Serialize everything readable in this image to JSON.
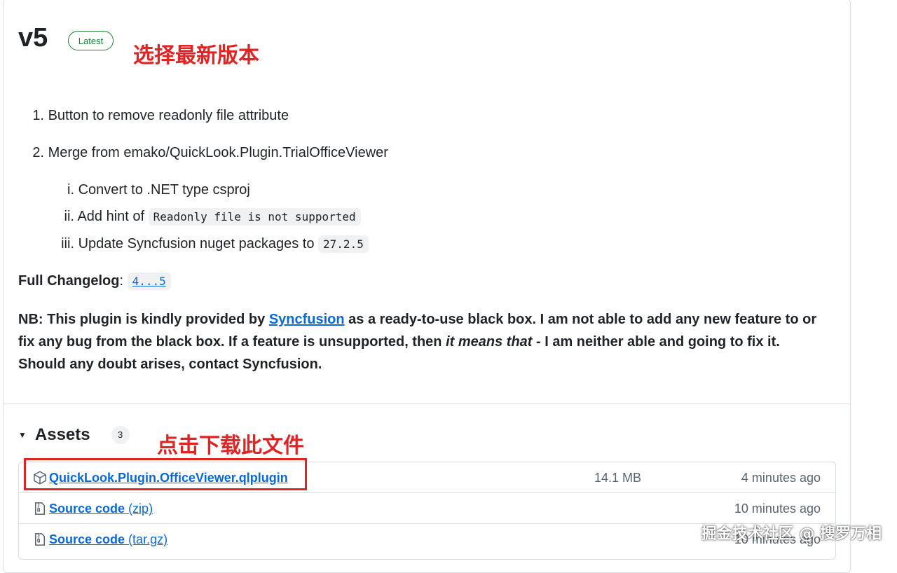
{
  "release": {
    "version": "v5",
    "badge": "Latest",
    "annotation_select": "选择最新版本",
    "notes": [
      {
        "num": "1.",
        "text": "Button to remove readonly file attribute"
      },
      {
        "num": "2.",
        "text": "Merge from emako/QuickLook.Plugin.TrialOfficeViewer"
      }
    ],
    "subnotes": [
      {
        "num": "i.",
        "text": "Convert to .NET type csproj",
        "code": ""
      },
      {
        "num": "ii.",
        "text": "Add hint of",
        "code": "Readonly file is not supported"
      },
      {
        "num": "iii.",
        "text": "Update Syncfusion nuget packages to",
        "code": "27.2.5"
      }
    ],
    "changelog_label": "Full Changelog",
    "changelog_link": "4...5",
    "nb_prefix": "NB: This plugin is kindly provided by",
    "nb_link": "Syncfusion",
    "nb_middle": "as a ready-to-use black box. I am not able to add any new feature to or fix any bug from the black box. If a feature is unsupported, then",
    "nb_italic": "it means that",
    "nb_suffix": "- I am neither able and going to fix it. Should any doubt arises, contact Syncfusion."
  },
  "assets": {
    "title": "Assets",
    "count": "3",
    "annotation_download": "点击下载此文件",
    "items": [
      {
        "name": "QuickLook.Plugin.OfficeViewer.qlplugin",
        "suffix": "",
        "size": "14.1 MB",
        "time": "4 minutes ago",
        "icon": "package-icon"
      },
      {
        "name": "Source code",
        "suffix": "(zip)",
        "size": "",
        "time": "10 minutes ago",
        "icon": "file-zip-icon"
      },
      {
        "name": "Source code",
        "suffix": "(tar.gz)",
        "size": "",
        "time": "10 minutes ago",
        "icon": "file-zip-icon"
      }
    ]
  },
  "watermark": "掘金技术社区 @ 搜罗万相",
  "colors": {
    "accent": "#0969da",
    "latest": "#1a7f37",
    "annotation": "#e02424"
  }
}
